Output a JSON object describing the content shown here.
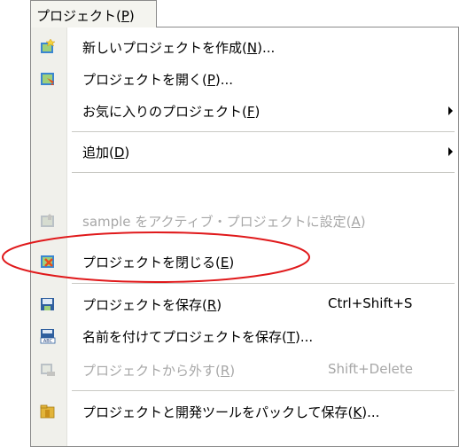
{
  "menu": {
    "title": "プロジェクト(",
    "title_key": "P",
    "title_end": ")"
  },
  "items": [
    {
      "label": "新しいプロジェクトを作成(",
      "key": "N",
      "tail": ")...",
      "shortcut": "",
      "icon": "new-project-icon"
    },
    {
      "label": "プロジェクトを開く(",
      "key": "P",
      "tail": ")...",
      "shortcut": "",
      "icon": "open-project-icon"
    },
    {
      "label": "お気に入りのプロジェクト(",
      "key": "F",
      "tail": ")",
      "shortcut": "",
      "icon": ""
    },
    {
      "label": "追加(",
      "key": "D",
      "tail": ")",
      "shortcut": "",
      "icon": ""
    },
    {
      "label": "sample をアクティブ・プロジェクトに設定(",
      "key": "A",
      "tail": ")",
      "shortcut": "",
      "icon": "set-active-project-icon"
    },
    {
      "label": "プロジェクトを閉じる(",
      "key": "E",
      "tail": ")",
      "shortcut": "",
      "icon": "close-project-icon"
    },
    {
      "label": "プロジェクトを保存(",
      "key": "R",
      "tail": ")",
      "shortcut": "Ctrl+Shift+S",
      "icon": "save-project-icon"
    },
    {
      "label": "名前を付けてプロジェクトを保存(",
      "key": "T",
      "tail": ")...",
      "shortcut": "",
      "icon": "save-as-icon"
    },
    {
      "label": "プロジェクトから外す(",
      "key": "R",
      "tail": ")",
      "shortcut": "Shift+Delete",
      "icon": "remove-project-icon"
    },
    {
      "label": "プロジェクトと開発ツールをパックして保存(",
      "key": "K",
      "tail": ")...",
      "shortcut": "",
      "icon": "pack-save-icon"
    }
  ],
  "colors": {
    "highlight_ellipse": "#e0191b",
    "disabled_text": "#a7a7a7"
  }
}
